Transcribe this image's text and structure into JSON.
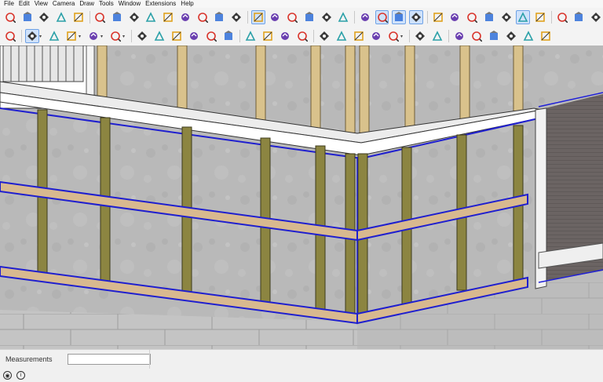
{
  "menu": [
    "File",
    "Edit",
    "View",
    "Camera",
    "Draw",
    "Tools",
    "Window",
    "Extensions",
    "Help"
  ],
  "toolbar_top": [
    {
      "icon": "select-icon"
    },
    {
      "icon": "eraser-icon"
    },
    {
      "icon": "paint-bucket-icon"
    },
    {
      "icon": "text-icon"
    },
    {
      "icon": "dimension-icon"
    },
    {
      "sep": true
    },
    {
      "icon": "orbit-icon"
    },
    {
      "icon": "pan-icon"
    },
    {
      "icon": "zoom-icon"
    },
    {
      "icon": "zoom-window-icon"
    },
    {
      "icon": "zoom-extents-icon"
    },
    {
      "icon": "previous-view-icon"
    },
    {
      "icon": "position-camera-icon"
    },
    {
      "icon": "look-around-icon"
    },
    {
      "icon": "walk-icon"
    },
    {
      "sep": true
    },
    {
      "icon": "iso-view-icon",
      "active": true
    },
    {
      "icon": "top-view-icon"
    },
    {
      "icon": "front-view-icon"
    },
    {
      "icon": "right-view-icon"
    },
    {
      "icon": "back-view-icon"
    },
    {
      "icon": "left-view-icon"
    },
    {
      "sep": true
    },
    {
      "icon": "perspective-icon"
    },
    {
      "icon": "parallel-projection-icon",
      "active": true
    },
    {
      "icon": "two-point-icon",
      "active": true
    },
    {
      "icon": "section-plane-icon",
      "active": true
    },
    {
      "sep": true
    },
    {
      "icon": "xray-icon"
    },
    {
      "icon": "back-edges-icon"
    },
    {
      "icon": "wireframe-icon"
    },
    {
      "icon": "hidden-line-icon"
    },
    {
      "icon": "shaded-icon"
    },
    {
      "icon": "shaded-textures-icon",
      "active": true
    },
    {
      "icon": "monochrome-icon"
    },
    {
      "sep": true
    },
    {
      "icon": "rotate-icon"
    },
    {
      "icon": "follow-me-icon"
    },
    {
      "icon": "offset-icon"
    }
  ],
  "toolbar_bottom": [
    {
      "icon": "search-icon"
    },
    {
      "sep": true
    },
    {
      "icon": "select-arrow-icon",
      "active": true,
      "dropdown": true
    },
    {
      "icon": "eraser-small-icon"
    },
    {
      "icon": "pencil-icon",
      "dropdown": true
    },
    {
      "icon": "arc-icon",
      "dropdown": true
    },
    {
      "icon": "rectangle-icon",
      "dropdown": true
    },
    {
      "sep": true
    },
    {
      "icon": "push-pull-icon"
    },
    {
      "icon": "follow-me-red-icon"
    },
    {
      "icon": "move-icon"
    },
    {
      "icon": "rotate-red-icon"
    },
    {
      "icon": "scale-icon"
    },
    {
      "icon": "offset-red-icon"
    },
    {
      "sep": true
    },
    {
      "icon": "tape-measure-icon"
    },
    {
      "icon": "protractor-icon"
    },
    {
      "icon": "zoom-small-icon"
    },
    {
      "icon": "axes-icon"
    },
    {
      "sep": true
    },
    {
      "icon": "sandbox-icon"
    },
    {
      "icon": "smoove-icon"
    },
    {
      "icon": "stamp-icon"
    },
    {
      "icon": "drape-icon"
    },
    {
      "icon": "profile-icon",
      "dropdown": true
    },
    {
      "sep": true
    },
    {
      "icon": "document-icon"
    },
    {
      "icon": "user-icon"
    },
    {
      "sep": true
    },
    {
      "icon": "shadow-icon"
    },
    {
      "icon": "pen-stroke-icon"
    },
    {
      "icon": "layers-icon"
    },
    {
      "icon": "paint-tray-icon"
    },
    {
      "icon": "component-icon"
    },
    {
      "icon": "extension-icon"
    }
  ],
  "statusbar": {
    "measurements_label": "Measurements",
    "measurements_value": ""
  }
}
